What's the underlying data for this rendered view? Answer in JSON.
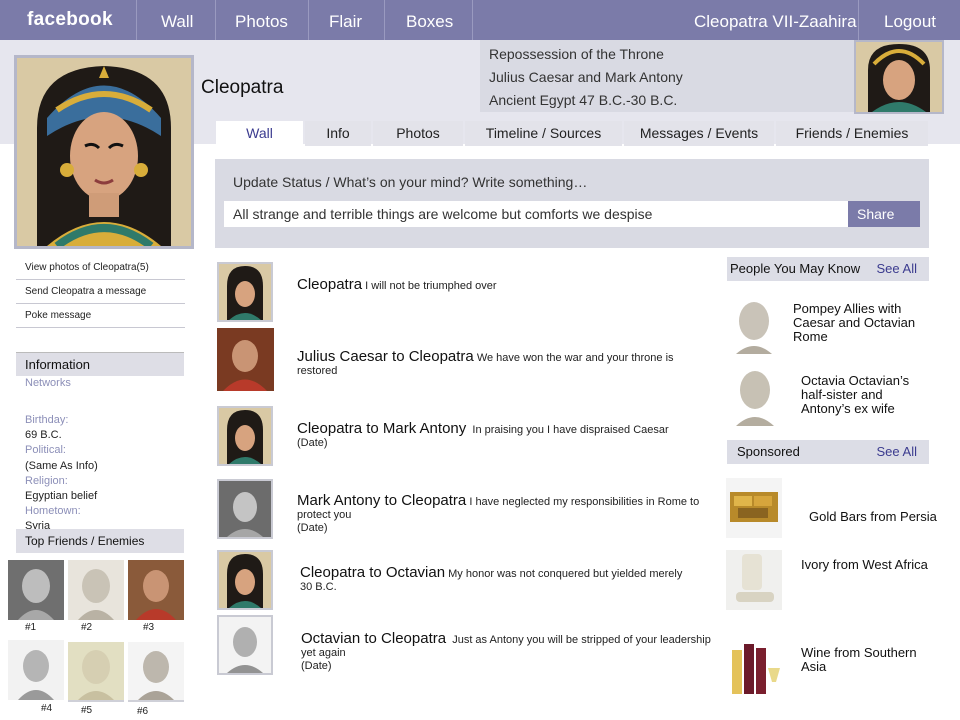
{
  "topbar": {
    "logo": "facebook",
    "nav": [
      "Wall",
      "Photos",
      "Flair",
      "Boxes"
    ],
    "user": "Cleopatra VII-Zaahira",
    "logout": "Logout"
  },
  "profile": {
    "name": "Cleopatra",
    "info_lines": [
      "Repossession of the Throne",
      "Julius Caesar and Mark Antony",
      "Ancient Egypt 47 B.C.-30 B.C."
    ]
  },
  "tabs": [
    "Wall",
    "Info",
    "Photos",
    "Timeline / Sources",
    "Messages / Events",
    "Friends / Enemies"
  ],
  "status": {
    "prompt": "Update Status / What’s on your mind?  Write something…",
    "value": "All strange and terrible things are welcome but comforts we despise",
    "share": "Share"
  },
  "left_links": [
    "View photos of Cleopatra(5)",
    "Send Cleopatra a message",
    "Poke message"
  ],
  "information": {
    "heading": "Information",
    "networks_label": "Networks",
    "birthday_label": "Birthday:",
    "birthday": "69 B.C.",
    "political_label": "Political:",
    "political": "(Same As Info)",
    "religion_label": "Religion:",
    "religion": "Egyptian belief",
    "hometown_label": "Hometown:",
    "hometown": "Syria"
  },
  "friends": {
    "heading": "Top Friends / Enemies",
    "labels": [
      "#1",
      "#2",
      "#3",
      "#4",
      "#5",
      "#6"
    ]
  },
  "posts": [
    {
      "head": "Cleopatra",
      "text": "I will not be triumphed over",
      "date": ""
    },
    {
      "head": "Julius Caesar to Cleopatra",
      "text": "We have won the war and your throne is restored",
      "date": ""
    },
    {
      "head": "Cleopatra to Mark Antony",
      "text": "In praising you I have dispraised Caesar",
      "date": "(Date)"
    },
    {
      "head": "Mark Antony to Cleopatra",
      "text": "I have neglected my responsibilities in Rome to protect you",
      "date": "(Date)"
    },
    {
      "head": "Cleopatra to Octavian",
      "text": "My honor was not conquered but yielded merely",
      "date": "30 B.C."
    },
    {
      "head": "Octavian to Cleopatra",
      "text": "Just as Antony you will be stripped of your leadership yet again",
      "date": "(Date)"
    }
  ],
  "people": {
    "heading": "People You May Know",
    "see_all": "See All",
    "items": [
      "Pompey Allies with Caesar and Octavian Rome",
      "Octavia  Octavian’s half-sister and Antony’s ex wife"
    ]
  },
  "sponsored": {
    "heading": "Sponsored",
    "see_all": "See All",
    "items": [
      "Gold Bars from Persia",
      "Ivory from West Africa",
      "Wine from Southern Asia"
    ]
  },
  "colors": {
    "topbar": "#7b7ba9",
    "panel": "#d9dae3",
    "link": "#3b3b8f"
  }
}
